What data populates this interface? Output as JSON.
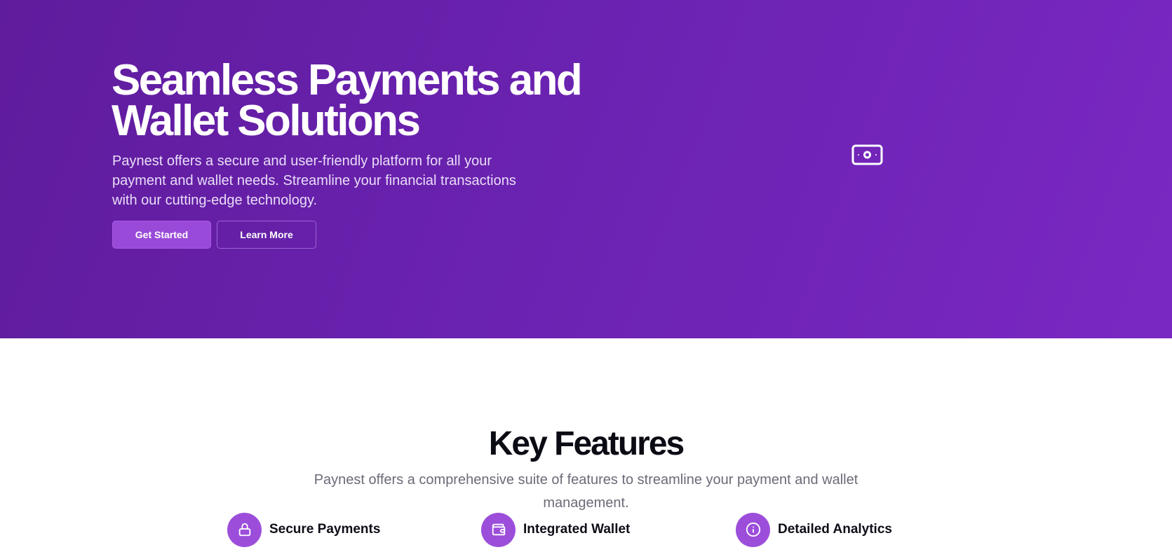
{
  "hero": {
    "title": "Seamless Payments and Wallet Solutions",
    "description": "Paynest offers a secure and user-friendly platform for all your payment and wallet needs. Streamline your financial transactions with our cutting-edge technology.",
    "primary_button": "Get Started",
    "secondary_button": "Learn More",
    "illustration_icon": "banknote-icon"
  },
  "features": {
    "title": "Key Features",
    "description": "Paynest offers a comprehensive suite of features to streamline your payment and wallet management.",
    "items": [
      {
        "icon": "lock-icon",
        "label": "Secure Payments"
      },
      {
        "icon": "wallet-icon",
        "label": "Integrated Wallet"
      },
      {
        "icon": "info-icon",
        "label": "Detailed Analytics"
      }
    ]
  },
  "colors": {
    "hero_gradient_start": "#5f1c9c",
    "hero_gradient_end": "#7a28c2",
    "accent": "#9c4edb",
    "heading": "#0b0b14",
    "muted_text": "#6b6b78"
  }
}
